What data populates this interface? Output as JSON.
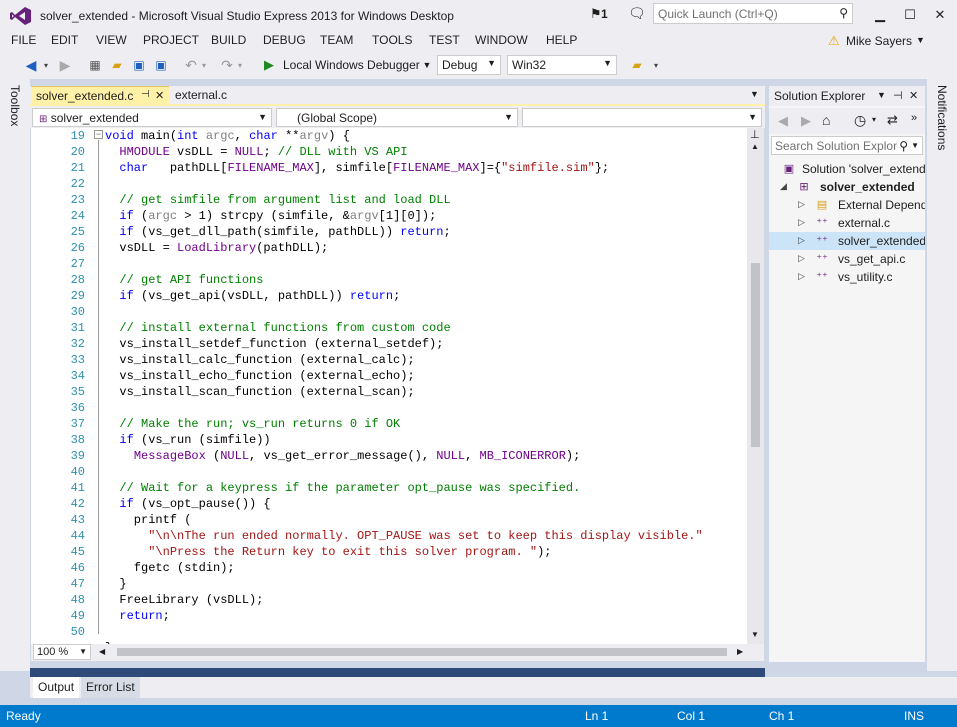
{
  "window": {
    "title": "solver_extended - Microsoft Visual Studio Express 2013 for Windows Desktop",
    "notif_count": "1",
    "quick_launch_placeholder": "Quick Launch (Ctrl+Q)",
    "user": "Mike Sayers"
  },
  "menu": [
    "FILE",
    "EDIT",
    "VIEW",
    "PROJECT",
    "BUILD",
    "DEBUG",
    "TEAM",
    "TOOLS",
    "TEST",
    "WINDOW",
    "HELP"
  ],
  "toolbar": {
    "debugger": "Local Windows Debugger",
    "config": "Debug",
    "platform": "Win32"
  },
  "side": {
    "left": "Toolbox",
    "right": "Notifications"
  },
  "tabs": [
    {
      "label": "solver_extended.c",
      "pin": "⊣"
    },
    {
      "label": "external.c"
    }
  ],
  "nav": {
    "file": "solver_extended",
    "scope": "(Global Scope)",
    "member": ""
  },
  "code_lines": [
    {
      "n": "19",
      "html": "<span class=\"kw\">void</span> main(<span class=\"kw\">int</span> <span class=\"gr\">argc</span>, <span class=\"kw\">char</span> **<span class=\"gr\">argv</span>) {"
    },
    {
      "n": "20",
      "html": "  <span class=\"mc\">HMODULE</span> vsDLL = <span class=\"mc\">NULL</span>; <span class=\"cm\">// DLL with VS API</span>"
    },
    {
      "n": "21",
      "html": "  <span class=\"kw\">char</span>   pathDLL[<span class=\"mc\">FILENAME_MAX</span>], simfile[<span class=\"mc\">FILENAME_MAX</span>]={<span class=\"st\">\"simfile.sim\"</span>};"
    },
    {
      "n": "22",
      "html": ""
    },
    {
      "n": "23",
      "html": "  <span class=\"cm\">// get simfile from argument list and load DLL</span>"
    },
    {
      "n": "24",
      "html": "  <span class=\"kw\">if</span> (<span class=\"gr\">argc</span> > 1) strcpy (simfile, &<span class=\"gr\">argv</span>[1][0]);"
    },
    {
      "n": "25",
      "html": "  <span class=\"kw\">if</span> (vs_get_dll_path(simfile, pathDLL)) <span class=\"kw\">return</span>;"
    },
    {
      "n": "26",
      "html": "  vsDLL = <span class=\"mc\">LoadLibrary</span>(pathDLL);"
    },
    {
      "n": "27",
      "html": ""
    },
    {
      "n": "28",
      "html": "  <span class=\"cm\">// get API functions</span>"
    },
    {
      "n": "29",
      "html": "  <span class=\"kw\">if</span> (vs_get_api(vsDLL, pathDLL)) <span class=\"kw\">return</span>;"
    },
    {
      "n": "30",
      "html": ""
    },
    {
      "n": "31",
      "html": "  <span class=\"cm\">// install external functions from custom code</span>"
    },
    {
      "n": "32",
      "html": "  vs_install_setdef_function (external_setdef);"
    },
    {
      "n": "33",
      "html": "  vs_install_calc_function (external_calc);"
    },
    {
      "n": "34",
      "html": "  vs_install_echo_function (external_echo);"
    },
    {
      "n": "35",
      "html": "  vs_install_scan_function (external_scan);"
    },
    {
      "n": "36",
      "html": ""
    },
    {
      "n": "37",
      "html": "  <span class=\"cm\">// Make the run; vs_run returns 0 if OK</span>"
    },
    {
      "n": "38",
      "html": "  <span class=\"kw\">if</span> (vs_run (simfile))"
    },
    {
      "n": "39",
      "html": "    <span class=\"mc\">MessageBox</span> (<span class=\"mc\">NULL</span>, vs_get_error_message(), <span class=\"mc\">NULL</span>, <span class=\"mc\">MB_ICONERROR</span>);"
    },
    {
      "n": "40",
      "html": ""
    },
    {
      "n": "41",
      "html": "  <span class=\"cm\">// Wait for a keypress if the parameter opt_pause was specified.</span>"
    },
    {
      "n": "42",
      "html": "  <span class=\"kw\">if</span> (vs_opt_pause()) {"
    },
    {
      "n": "43",
      "html": "    printf ("
    },
    {
      "n": "44",
      "html": "      <span class=\"st\">\"\\n\\nThe run ended normally. OPT_PAUSE was set to keep this display visible.\"</span>"
    },
    {
      "n": "45",
      "html": "      <span class=\"st\">\"\\nPress the Return key to exit this solver program. \"</span>);"
    },
    {
      "n": "46",
      "html": "    fgetc (stdin);"
    },
    {
      "n": "47",
      "html": "  }"
    },
    {
      "n": "48",
      "html": "  FreeLibrary (vsDLL);"
    },
    {
      "n": "49",
      "html": "  <span class=\"kw\">return</span>;"
    },
    {
      "n": "50",
      "html": ""
    },
    {
      "n": "",
      "html": "}"
    }
  ],
  "zoom": "100 %",
  "solution_explorer": {
    "title": "Solution Explorer",
    "search_placeholder": "Search Solution Explor",
    "items": [
      {
        "label": "Solution 'solver_extend",
        "indent": 0,
        "arrow": "",
        "icon": "solution-icon"
      },
      {
        "label": "solver_extended",
        "indent": 1,
        "arrow": "◢",
        "icon": "project-icon",
        "bold": true
      },
      {
        "label": "External Depend",
        "indent": 2,
        "arrow": "▷",
        "icon": "folder-icon"
      },
      {
        "label": "external.c",
        "indent": 2,
        "arrow": "▷",
        "icon": "c-file-icon"
      },
      {
        "label": "solver_extended.",
        "indent": 2,
        "arrow": "▷",
        "icon": "c-file-icon",
        "selected": true
      },
      {
        "label": "vs_get_api.c",
        "indent": 2,
        "arrow": "▷",
        "icon": "c-file-icon"
      },
      {
        "label": "vs_utility.c",
        "indent": 2,
        "arrow": "▷",
        "icon": "c-file-icon"
      }
    ]
  },
  "bottom_tabs": [
    "Output",
    "Error List"
  ],
  "status": {
    "ready": "Ready",
    "ln": "Ln 1",
    "col": "Col 1",
    "ch": "Ch 1",
    "ins": "INS"
  },
  "colors": {
    "accent": "#007acc",
    "tab_active": "#fff1a8",
    "vs_purple": "#68217a"
  }
}
